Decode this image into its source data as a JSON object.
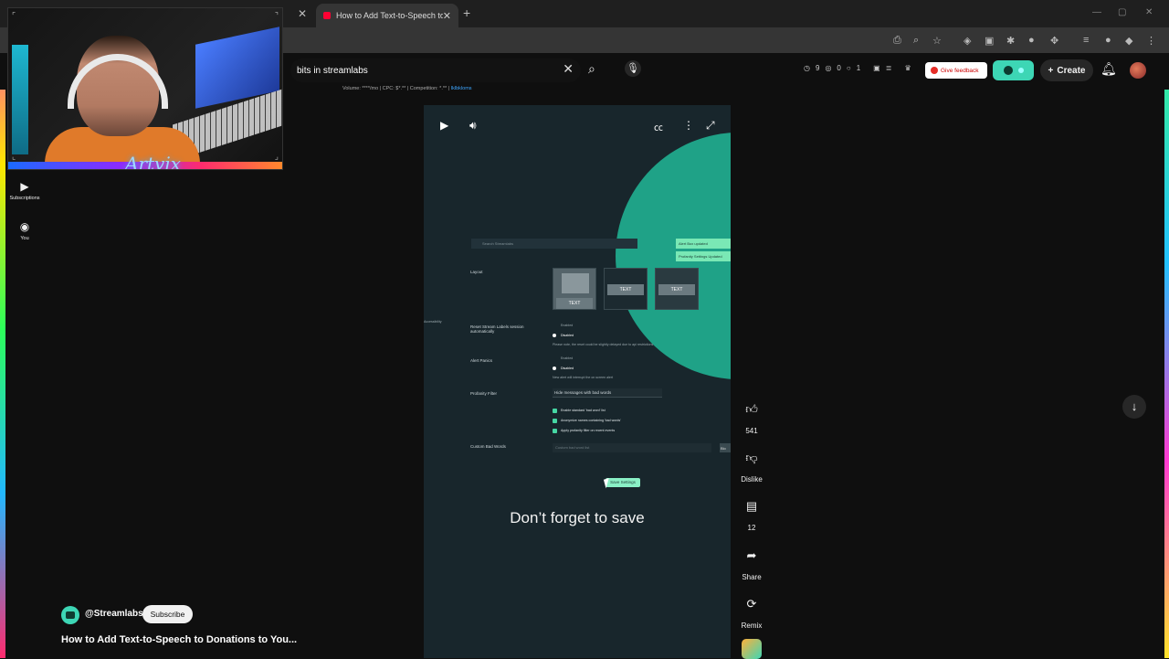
{
  "browser": {
    "tab_title": "How to Add Text-to-Speech to",
    "tab_close": "✕",
    "prev_tab_close": "✕",
    "new_tab": "+"
  },
  "header": {
    "search_value": "bits in streamlabs",
    "keyword_info": "Volume: ****/mo | CPC: $*.** | Competition: *.** |",
    "keyword_link": "Iklbkloms",
    "stats": [
      "9",
      "0",
      "1"
    ],
    "feedback_label": "Give feedback",
    "create_label": "Create"
  },
  "sidebar": {
    "subscriptions_label": "Subscriptions",
    "you_label": "You"
  },
  "webcam": {
    "signature": "Artvix"
  },
  "player": {
    "caption": "Don’t forget to save",
    "inner": {
      "search_placeholder": "Search Streamlabs",
      "toast1": "Alert Box updated",
      "toast2": "Profanity Settings Updated",
      "layout_label": "Layout",
      "layout_text": "TEXT",
      "accessibility_label": "Accessibility",
      "reset_label": "Reset Stream Labels session automatically",
      "enabled": "Enabled",
      "disabled": "Disabled",
      "reset_note": "Please note, the reset could be slightly delayed due to api restrictions",
      "alert_panic_label": "Alert Panics",
      "alert_note": "New alert will interrupt the on screen alert",
      "profanity_label": "Profanity Filter",
      "profanity_select": "Hide messages with bad words",
      "check1": "Enable standard 'bad word' list",
      "check2": "Anonymize names containing 'bad words'",
      "check3": "Apply profanity filter on recent events",
      "custom_label": "Custom Bad Words",
      "custom_placeholder": "Custom bad word list",
      "block_btn": "Blo",
      "save_btn": "Save Settings"
    }
  },
  "actions": {
    "like_count": "541",
    "dislike_label": "Dislike",
    "comment_count": "12",
    "share_label": "Share",
    "remix_label": "Remix"
  },
  "short": {
    "channel": "@Streamlabs",
    "subscribe": "Subscribe",
    "title": "How to Add Text-to-Speech to Donations to You..."
  }
}
